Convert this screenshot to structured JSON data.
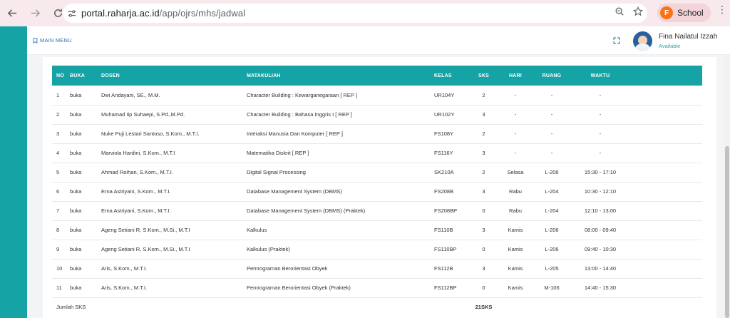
{
  "browser": {
    "url_domain": "portal.raharja.ac.id",
    "url_path": "/app/ojrs/mhs/jadwal",
    "profile_initial": "F",
    "profile_label": "School"
  },
  "topbar": {
    "main_menu": "MAIN MENU",
    "user_name": "Fina Nailatul Izzah",
    "user_status": "Available"
  },
  "table": {
    "headers": [
      "NO",
      "BUKA",
      "DOSEN",
      "MATAKULIAH",
      "KELAS",
      "SKS",
      "HARI",
      "RUANG",
      "WAKTU"
    ],
    "rows": [
      {
        "no": "1",
        "buka": "buka",
        "dosen": "Dwi Andayani, SE., M.M.",
        "mk": "Character Building : Kewarganegaraan [ REP ]",
        "kelas": "UR104Y",
        "sks": "2",
        "hari": "-",
        "ruang": "-",
        "waktu": "-"
      },
      {
        "no": "2",
        "buka": "buka",
        "dosen": "Muhamad Iip Suhaepi, S.Pd.,M.Pd.",
        "mk": "Character Building : Bahasa Inggris I [ REP ]",
        "kelas": "UR102Y",
        "sks": "3",
        "hari": "-",
        "ruang": "-",
        "waktu": "-"
      },
      {
        "no": "3",
        "buka": "buka",
        "dosen": "Nuke Puji Lestari Santoso, S.Kom., M.T.I.",
        "mk": "Interaksi Manusia Dan Komputer [ REP ]",
        "kelas": "FS108Y",
        "sks": "2",
        "hari": "-",
        "ruang": "-",
        "waktu": "-"
      },
      {
        "no": "4",
        "buka": "buka",
        "dosen": "Marviola Hardini, S.Kom., M.T.I",
        "mk": "Matematika Diskrit [ REP ]",
        "kelas": "FS116Y",
        "sks": "3",
        "hari": "-",
        "ruang": "-",
        "waktu": "-"
      },
      {
        "no": "5",
        "buka": "buka",
        "dosen": "Ahmad Roihan, S.Kom., M.T.I.",
        "mk": "Digital Signal Processing",
        "kelas": "SK210A",
        "sks": "2",
        "hari": "Selasa",
        "ruang": "L-206",
        "waktu": "15:30 - 17:10"
      },
      {
        "no": "6",
        "buka": "buka",
        "dosen": "Erna Astriyani, S.Kom., M.T.I.",
        "mk": "Database Management System (DBMS)",
        "kelas": "FS208B",
        "sks": "3",
        "hari": "Rabu",
        "ruang": "L-204",
        "waktu": "10:30 - 12:10"
      },
      {
        "no": "7",
        "buka": "buka",
        "dosen": "Erna Astriyani, S.Kom., M.T.I.",
        "mk": "Database Management System (DBMS) (Praktek)",
        "kelas": "FS208BP",
        "sks": "0",
        "hari": "Rabu",
        "ruang": "L-204",
        "waktu": "12:10 - 13:00"
      },
      {
        "no": "8",
        "buka": "buka",
        "dosen": "Ageng Setiani R, S.Kom., M.Si., M.T.I",
        "mk": "Kalkulus",
        "kelas": "FS110B",
        "sks": "3",
        "hari": "Kamis",
        "ruang": "L-206",
        "waktu": "08:00 - 09:40"
      },
      {
        "no": "9",
        "buka": "buka",
        "dosen": "Ageng Setiani R, S.Kom., M.Si., M.T.I",
        "mk": "Kalkulus (Praktek)",
        "kelas": "FS110BP",
        "sks": "0",
        "hari": "Kamis",
        "ruang": "L-206",
        "waktu": "09:40 - 10:30"
      },
      {
        "no": "10",
        "buka": "buka",
        "dosen": "Aris, S.Kom., M.T.I.",
        "mk": "Pemrograman Berorientasi Obyek",
        "kelas": "FS112B",
        "sks": "3",
        "hari": "Kamis",
        "ruang": "L-205",
        "waktu": "13:00 - 14:40"
      },
      {
        "no": "11",
        "buka": "buka",
        "dosen": "Aris, S.Kom., M.T.I.",
        "mk": "Pemrograman Berorientasi Obyek (Praktek)",
        "kelas": "FS112BP",
        "sks": "0",
        "hari": "Kamis",
        "ruang": "M-106",
        "waktu": "14:40 - 15:30"
      }
    ],
    "footer_label": "Jumlah SKS",
    "footer_total": "21SKS"
  },
  "colors": {
    "accent": "#16a3a6",
    "browser_bar": "#f8e9ec"
  }
}
